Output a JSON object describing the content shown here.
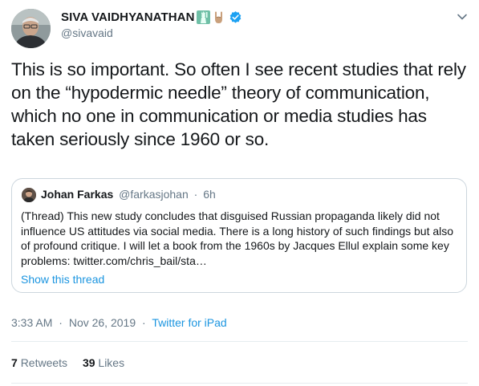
{
  "author": {
    "display_name": "SIVA VAIDHYANATHAN",
    "handle": "@sivavaid",
    "name_icons": [
      "statue-of-liberty-emoji",
      "sign-of-horns-emoji",
      "verified-badge"
    ]
  },
  "tweet": {
    "text": "This is so important. So often I see recent studies that rely on the “hypodermic needle” theory of communication, which no one in communication or media studies has taken seriously since 1960 or so."
  },
  "quoted_tweet": {
    "display_name": "Johan Farkas",
    "handle": "@farkasjohan",
    "separator": "·",
    "time": "6h",
    "text": "(Thread) This new study concludes that disguised Russian propaganda likely did not influence US attitudes via social media. There is a long history of such findings but also of profound critique. I will let a book from the 1960s by Jacques Ellul explain some key problems: twitter.com/chris_bail/sta…",
    "show_thread_label": "Show this thread"
  },
  "meta": {
    "time": "3:33 AM",
    "date": "Nov 26, 2019",
    "separator": "·",
    "source": "Twitter for iPad"
  },
  "stats": {
    "retweets_count": "7",
    "retweets_label": "Retweets",
    "likes_count": "39",
    "likes_label": "Likes"
  },
  "colors": {
    "link": "#1b95e0",
    "secondary_text": "#657786",
    "border": "#ccd6dd",
    "divider": "#e6ecf0",
    "verified": "#1da1f2"
  }
}
